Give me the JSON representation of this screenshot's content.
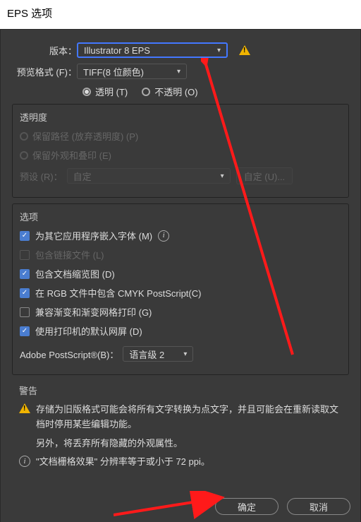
{
  "title": "EPS 选项",
  "version": {
    "label": "版本：",
    "value": "Illustrator 8 EPS"
  },
  "preview": {
    "label": "预览格式 (F)：",
    "value": "TIFF(8 位颜色)",
    "radio_transparent": "透明 (T)",
    "radio_opaque": "不透明 (O)"
  },
  "transparency": {
    "title": "透明度",
    "preserve_paths": "保留路径 (放弃透明度) (P)",
    "preserve_appearance": "保留外观和叠印 (E)",
    "preset_label": "预设 (R)：",
    "preset_value": "自定",
    "custom_button": "自定 (U)..."
  },
  "options": {
    "title": "选项",
    "embed_fonts": "为其它应用程序嵌入字体 (M)",
    "include_linked": "包含链接文件 (L)",
    "include_thumb": "包含文档缩览图 (D)",
    "cmyk_in_rgb": "在 RGB 文件中包含 CMYK PostScript(C)",
    "compat_gradient": "兼容渐变和渐变网格打印 (G)",
    "use_printer_default": "使用打印机的默认网屏 (D)",
    "postscript_label": "Adobe PostScript®(B)：",
    "postscript_value": "语言级 2"
  },
  "warnings": {
    "title": "警告",
    "w1": "存储为旧版格式可能会将所有文字转换为点文字，并且可能会在重新读取文档时停用某些编辑功能。",
    "w2": "另外，将丢弃所有隐藏的外观属性。",
    "w3": "\"文档栅格效果\" 分辨率等于或小于 72 ppi。"
  },
  "buttons": {
    "ok": "确定",
    "cancel": "取消"
  }
}
